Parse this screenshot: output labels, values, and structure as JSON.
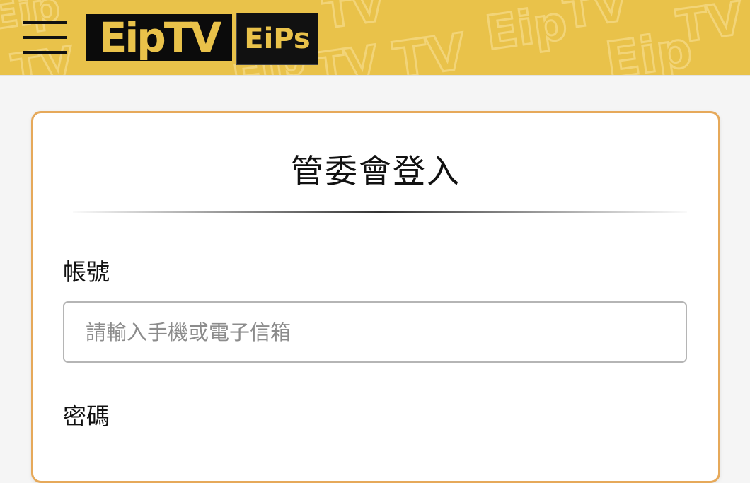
{
  "header": {
    "menu_icon": "hamburger-menu-icon",
    "logo": {
      "tv_text": "EipTV",
      "eips_text": "EiPs"
    },
    "colors": {
      "brand_yellow": "#e9c24a",
      "logo_black": "#0b0b0b"
    }
  },
  "login": {
    "title": "管委會登入",
    "account_label": "帳號",
    "account_placeholder": "請輸入手機或電子信箱",
    "account_value": "",
    "password_label": "密碼",
    "card_border_color": "#e6a95a"
  }
}
